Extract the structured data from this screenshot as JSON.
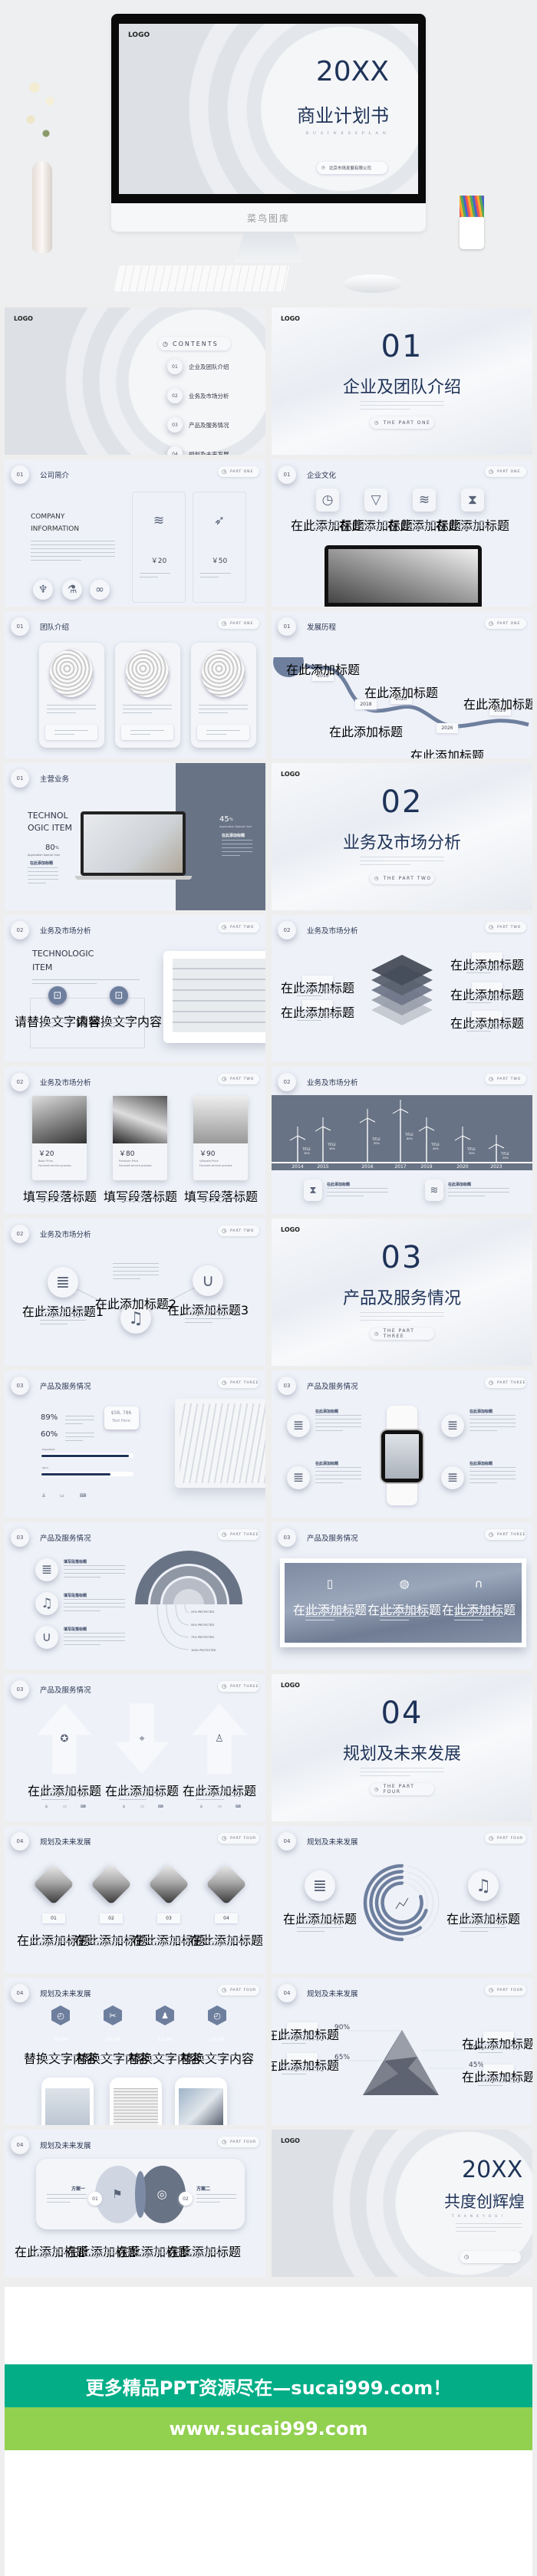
{
  "hero": {
    "logo": "LOGO",
    "year": "20XX",
    "title": "商业计划书",
    "subtitle": "B U S I N E S S   P L A N",
    "company": "北京市场发展有限公司",
    "brand": "菜鸟图库"
  },
  "colors": {
    "navy": "#1f3358",
    "slate": "#687385",
    "slide_bg": "#eef1f8",
    "banner_green": "#03ae87",
    "banner_lime": "#92d050"
  },
  "slides": [
    {
      "type": "toc",
      "logo": "LOGO",
      "heading": "CONTENTS",
      "items": [
        {
          "num": "01",
          "label": "企业及团队介绍"
        },
        {
          "num": "02",
          "label": "业务及市场分析"
        },
        {
          "num": "03",
          "label": "产品及服务情况"
        },
        {
          "num": "04",
          "label": "规划及未来发展"
        }
      ]
    },
    {
      "type": "section",
      "logo": "LOGO",
      "num": "01",
      "title": "企业及团队介绍",
      "part": "THE PART ONE"
    },
    {
      "type": "content",
      "layout": "company",
      "num": "01",
      "title": "公司简介",
      "part": "PART ONE",
      "heading": [
        "COMPANY",
        "INFORMATION"
      ],
      "prices": [
        "￥20",
        "￥50"
      ]
    },
    {
      "type": "content",
      "layout": "culture",
      "num": "01",
      "title": "企业文化",
      "part": "PART ONE",
      "cards": [
        "在此添加标题",
        "在此添加标题",
        "在此添加标题",
        "在此添加标题"
      ]
    },
    {
      "type": "content",
      "layout": "team",
      "num": "01",
      "title": "团队介绍",
      "part": "PART ONE"
    },
    {
      "type": "content",
      "layout": "timeline",
      "num": "01",
      "title": "发展历程",
      "part": "PART ONE",
      "years": [
        "2016",
        "2018",
        "2020",
        "2026",
        "2029"
      ],
      "captions": [
        "在此添加标题",
        "在此添加标题",
        "在此添加标题",
        "在此添加标题",
        "在此添加标题"
      ]
    },
    {
      "type": "content",
      "layout": "business",
      "num": "01",
      "title": "主营业务",
      "part": "PART ONE",
      "heading": [
        "TECHNOL",
        "OGIC ITEM"
      ],
      "stats": [
        {
          "value": "80",
          "unit": "%",
          "label": "Application Special User",
          "caption": "在此添加标题"
        },
        {
          "value": "45",
          "unit": "%",
          "label": "Application Special User",
          "caption": "在此添加标题"
        }
      ]
    },
    {
      "type": "section",
      "logo": "LOGO",
      "num": "02",
      "title": "业务及市场分析",
      "part": "THE PART TWO"
    },
    {
      "type": "content",
      "layout": "tech",
      "num": "02",
      "title": "业务及市场分析",
      "part": "PART TWO",
      "heading": [
        "TECHNOLOGIC",
        "ITEM"
      ],
      "items": [
        "请替换文字内容",
        "请替换文字内容"
      ]
    },
    {
      "type": "content",
      "layout": "layers",
      "num": "02",
      "title": "业务及市场分析",
      "part": "PART TWO",
      "labels": [
        "在此添加标题",
        "在此添加标题",
        "在此添加标题",
        "在此添加标题",
        "在此添加标题"
      ]
    },
    {
      "type": "content",
      "layout": "prices",
      "num": "02",
      "title": "业务及市场分析",
      "part": "PART TWO",
      "cards": [
        {
          "price": "￥20",
          "tier": "Basic Price",
          "note": "Focused service process",
          "caption": "填写段落标题"
        },
        {
          "price": "￥80",
          "tier": "Premium Price",
          "note": "Focused service process",
          "caption": "填写段落标题"
        },
        {
          "price": "￥90",
          "tier": "Ultimate Price",
          "note": "Focused service process",
          "caption": "填写段落标题"
        }
      ]
    },
    {
      "type": "content",
      "layout": "windmills",
      "num": "02",
      "title": "业务及市场分析",
      "part": "PART TWO",
      "turbines": [
        {
          "year": "2014",
          "label": "TITLE",
          "value": "30%",
          "level": 30
        },
        {
          "year": "2015",
          "label": "TITLE",
          "value": "40%",
          "level": 40
        },
        {
          "year": "2016",
          "label": "TITLE",
          "value": "50%",
          "level": 50
        },
        {
          "year": "2017",
          "label": "TITLE",
          "value": "60%",
          "level": 60
        },
        {
          "year": "2019",
          "label": "TITLE",
          "value": "40%",
          "level": 40
        },
        {
          "year": "2020",
          "label": "TITLE",
          "value": "30%",
          "level": 30
        },
        {
          "year": "2023",
          "label": "TITLE",
          "value": "20%",
          "level": 20
        }
      ],
      "items": [
        "在此添加标题",
        "在此添加标题"
      ]
    },
    {
      "type": "content",
      "layout": "circles",
      "num": "02",
      "title": "业务及市场分析",
      "part": "PART TWO",
      "captions": [
        "在此添加标题1",
        "在此添加标题2",
        "在此添加标题3"
      ]
    },
    {
      "type": "section",
      "logo": "LOGO",
      "num": "03",
      "title": "产品及服务情况",
      "part": "THE PART THREE"
    },
    {
      "type": "content",
      "layout": "stats",
      "num": "03",
      "title": "产品及服务情况",
      "part": "PART THREE",
      "percents": [
        "89%",
        "60%"
      ],
      "bubble": [
        "$58, 786",
        "Text Here"
      ],
      "bars": [
        {
          "label": "PowerPoint",
          "fill": 0.95
        },
        {
          "label": "Word",
          "fill": 0.75
        }
      ]
    },
    {
      "type": "content",
      "layout": "watch",
      "num": "03",
      "title": "产品及服务情况",
      "part": "PART THREE",
      "captions": [
        "在此添加标题",
        "在此添加标题",
        "在此添加标题",
        "在此添加标题"
      ]
    },
    {
      "type": "content",
      "layout": "rainbow",
      "num": "03",
      "title": "产品及服务情况",
      "part": "PART THREE",
      "items": [
        "填写段落标题",
        "填写段落标题",
        "填写段落标题"
      ],
      "labels": [
        "25% PROTECTED",
        "50% PROTECTED",
        "75% PROTECTED",
        "100% PROTECTED"
      ]
    },
    {
      "type": "content",
      "layout": "mountain",
      "num": "03",
      "title": "产品及服务情况",
      "part": "PART THREE",
      "captions": [
        "在此添加标题",
        "在此添加标题",
        "在此添加标题"
      ]
    },
    {
      "type": "content",
      "layout": "arrows",
      "num": "03",
      "title": "产品及服务情况",
      "part": "PART THREE",
      "captions": [
        "在此添加标题",
        "在此添加标题",
        "在此添加标题"
      ]
    },
    {
      "type": "section",
      "logo": "LOGO",
      "num": "04",
      "title": "规划及未来发展",
      "part": "THE PART FOUR"
    },
    {
      "type": "content",
      "layout": "diamonds",
      "num": "04",
      "title": "规划及未来发展",
      "part": "PART FOUR",
      "nums": [
        "01",
        "02",
        "03",
        "04"
      ],
      "captions": [
        "在此添加标题",
        "在此添加标题",
        "在此添加标题",
        "在此添加标题"
      ]
    },
    {
      "type": "content",
      "layout": "rings",
      "num": "04",
      "title": "规划及未来发展",
      "part": "PART FOUR",
      "rings": [
        {
          "label": "50%",
          "level": 50
        },
        {
          "label": "60%",
          "level": 60
        },
        {
          "label": "70%",
          "level": 70
        },
        {
          "label": "80%",
          "level": 80
        }
      ],
      "captions": [
        "在此添加标题",
        "在此添加标题"
      ]
    },
    {
      "type": "content",
      "layout": "hexagons",
      "num": "04",
      "title": "规划及未来发展",
      "part": "PART FOUR",
      "times": [
        "09:00",
        "10:00",
        "11:00",
        "12:00"
      ],
      "captions": [
        "替换文字内容",
        "替换文字内容",
        "替换文字内容",
        "替换文字内容"
      ]
    },
    {
      "type": "content",
      "layout": "pyramid",
      "num": "04",
      "title": "规划及未来发展",
      "part": "PART FOUR",
      "values": [
        "90%",
        "65%",
        "70%",
        "45%"
      ],
      "labels": [
        "在此添加标题",
        "在此添加标题",
        "在此添加标题",
        "在此添加标题"
      ]
    },
    {
      "type": "content",
      "layout": "venn",
      "num": "04",
      "title": "规划及未来发展",
      "part": "PART FOUR",
      "plans": [
        "方案一",
        "方案二"
      ],
      "nums": [
        "01",
        "02"
      ],
      "captions": [
        "在此添加标题",
        "在此添加标题",
        "在此添加标题",
        "在此添加标题"
      ]
    },
    {
      "type": "closing",
      "logo": "LOGO",
      "year": "20XX",
      "title": "共度创辉煌",
      "subtitle": "T H A N K   Y O U   !"
    }
  ],
  "banner": {
    "headline": "更多精品PPT资源尽在—sucai999.com！",
    "url": "www.sucai999.com"
  }
}
